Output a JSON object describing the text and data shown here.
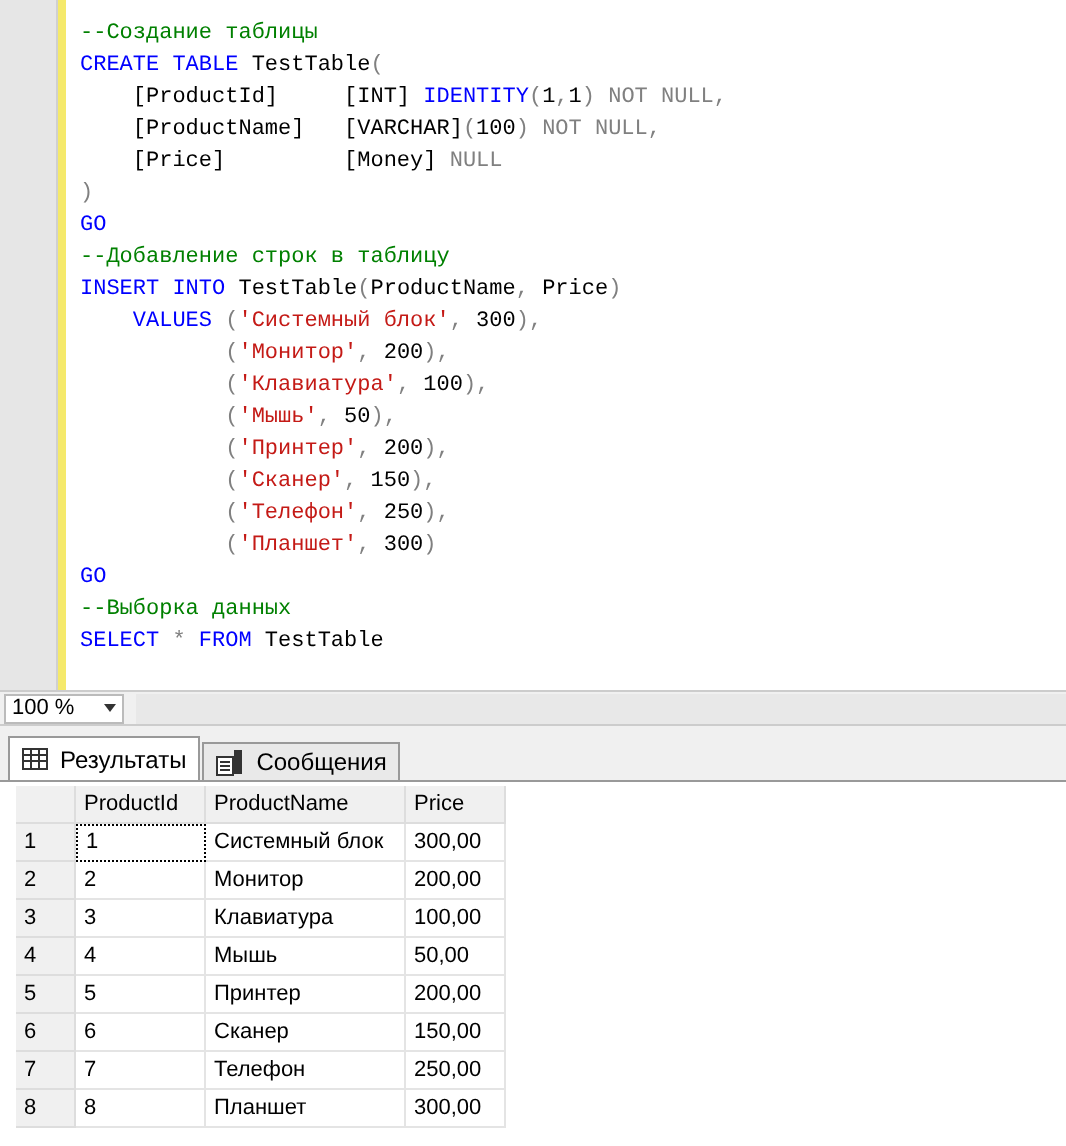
{
  "editor": {
    "lines": [
      {
        "tokens": [
          {
            "kind": "comment",
            "text": "--Создание таблицы"
          }
        ]
      },
      {
        "tokens": [
          {
            "kind": "keyword",
            "text": "CREATE"
          },
          {
            "kind": "keyword",
            "text": " TABLE"
          },
          {
            "kind": "plain",
            "text": " TestTable"
          },
          {
            "kind": "operator",
            "text": "("
          }
        ]
      },
      {
        "tokens": [
          {
            "kind": "plain",
            "text": "    [ProductId]     [INT] "
          },
          {
            "kind": "keyword",
            "text": "IDENTITY"
          },
          {
            "kind": "operator",
            "text": "("
          },
          {
            "kind": "plain",
            "text": "1"
          },
          {
            "kind": "operator",
            "text": ","
          },
          {
            "kind": "plain",
            "text": "1"
          },
          {
            "kind": "operator",
            "text": ")"
          },
          {
            "kind": "operator",
            "text": " NOT NULL,"
          }
        ]
      },
      {
        "tokens": [
          {
            "kind": "plain",
            "text": "    [ProductName]   [VARCHAR]"
          },
          {
            "kind": "operator",
            "text": "("
          },
          {
            "kind": "plain",
            "text": "100"
          },
          {
            "kind": "operator",
            "text": ")"
          },
          {
            "kind": "operator",
            "text": " NOT NULL,"
          }
        ]
      },
      {
        "tokens": [
          {
            "kind": "plain",
            "text": "    [Price]         [Money] "
          },
          {
            "kind": "operator",
            "text": "NULL"
          }
        ]
      },
      {
        "tokens": [
          {
            "kind": "operator",
            "text": ")"
          }
        ]
      },
      {
        "tokens": [
          {
            "kind": "keyword",
            "text": "GO"
          }
        ]
      },
      {
        "tokens": [
          {
            "kind": "comment",
            "text": "--Добавление строк в таблицу"
          }
        ]
      },
      {
        "tokens": [
          {
            "kind": "keyword",
            "text": "INSERT"
          },
          {
            "kind": "keyword",
            "text": " INTO"
          },
          {
            "kind": "plain",
            "text": " TestTable"
          },
          {
            "kind": "operator",
            "text": "("
          },
          {
            "kind": "plain",
            "text": "ProductName"
          },
          {
            "kind": "operator",
            "text": ","
          },
          {
            "kind": "plain",
            "text": " Price"
          },
          {
            "kind": "operator",
            "text": ")"
          }
        ]
      },
      {
        "tokens": [
          {
            "kind": "keyword",
            "text": "    VALUES"
          },
          {
            "kind": "operator",
            "text": " ("
          },
          {
            "kind": "string",
            "text": "'Системный блок'"
          },
          {
            "kind": "operator",
            "text": ","
          },
          {
            "kind": "plain",
            "text": " 300"
          },
          {
            "kind": "operator",
            "text": "),"
          }
        ]
      },
      {
        "tokens": [
          {
            "kind": "operator",
            "text": "           ("
          },
          {
            "kind": "string",
            "text": "'Монитор'"
          },
          {
            "kind": "operator",
            "text": ","
          },
          {
            "kind": "plain",
            "text": " 200"
          },
          {
            "kind": "operator",
            "text": "),"
          }
        ]
      },
      {
        "tokens": [
          {
            "kind": "operator",
            "text": "           ("
          },
          {
            "kind": "string",
            "text": "'Клавиатура'"
          },
          {
            "kind": "operator",
            "text": ","
          },
          {
            "kind": "plain",
            "text": " 100"
          },
          {
            "kind": "operator",
            "text": "),"
          }
        ]
      },
      {
        "tokens": [
          {
            "kind": "operator",
            "text": "           ("
          },
          {
            "kind": "string",
            "text": "'Мышь'"
          },
          {
            "kind": "operator",
            "text": ","
          },
          {
            "kind": "plain",
            "text": " 50"
          },
          {
            "kind": "operator",
            "text": "),"
          }
        ]
      },
      {
        "tokens": [
          {
            "kind": "operator",
            "text": "           ("
          },
          {
            "kind": "string",
            "text": "'Принтер'"
          },
          {
            "kind": "operator",
            "text": ","
          },
          {
            "kind": "plain",
            "text": " 200"
          },
          {
            "kind": "operator",
            "text": "),"
          }
        ]
      },
      {
        "tokens": [
          {
            "kind": "operator",
            "text": "           ("
          },
          {
            "kind": "string",
            "text": "'Сканер'"
          },
          {
            "kind": "operator",
            "text": ","
          },
          {
            "kind": "plain",
            "text": " 150"
          },
          {
            "kind": "operator",
            "text": "),"
          }
        ]
      },
      {
        "tokens": [
          {
            "kind": "operator",
            "text": "           ("
          },
          {
            "kind": "string",
            "text": "'Телефон'"
          },
          {
            "kind": "operator",
            "text": ","
          },
          {
            "kind": "plain",
            "text": " 250"
          },
          {
            "kind": "operator",
            "text": "),"
          }
        ]
      },
      {
        "tokens": [
          {
            "kind": "operator",
            "text": "           ("
          },
          {
            "kind": "string",
            "text": "'Планшет'"
          },
          {
            "kind": "operator",
            "text": ","
          },
          {
            "kind": "plain",
            "text": " 300"
          },
          {
            "kind": "operator",
            "text": ")"
          }
        ]
      },
      {
        "tokens": [
          {
            "kind": "keyword",
            "text": "GO"
          }
        ]
      },
      {
        "tokens": [
          {
            "kind": "comment",
            "text": "--Выборка данных"
          }
        ]
      },
      {
        "tokens": [
          {
            "kind": "keyword",
            "text": "SELECT"
          },
          {
            "kind": "operator",
            "text": " *"
          },
          {
            "kind": "keyword",
            "text": " FROM"
          },
          {
            "kind": "plain",
            "text": " TestTable"
          }
        ]
      }
    ]
  },
  "zoom": {
    "value": "100 %"
  },
  "tabs": [
    {
      "label": "Результаты",
      "kind": "grid",
      "selected": true
    },
    {
      "label": "Сообщения",
      "kind": "messages",
      "selected": false
    }
  ],
  "results": {
    "columns": [
      "ProductId",
      "ProductName",
      "Price"
    ],
    "rows": [
      {
        "number": "1",
        "cells": [
          "1",
          "Системный блок",
          "300,00"
        ],
        "focused": true
      },
      {
        "number": "2",
        "cells": [
          "2",
          "Монитор",
          "200,00"
        ],
        "focused": false
      },
      {
        "number": "3",
        "cells": [
          "3",
          "Клавиатура",
          "100,00"
        ],
        "focused": false
      },
      {
        "number": "4",
        "cells": [
          "4",
          "Мышь",
          "50,00"
        ],
        "focused": false
      },
      {
        "number": "5",
        "cells": [
          "5",
          "Принтер",
          "200,00"
        ],
        "focused": false
      },
      {
        "number": "6",
        "cells": [
          "6",
          "Сканер",
          "150,00"
        ],
        "focused": false
      },
      {
        "number": "7",
        "cells": [
          "7",
          "Телефон",
          "250,00"
        ],
        "focused": false
      },
      {
        "number": "8",
        "cells": [
          "8",
          "Планшет",
          "300,00"
        ],
        "focused": false
      }
    ]
  }
}
